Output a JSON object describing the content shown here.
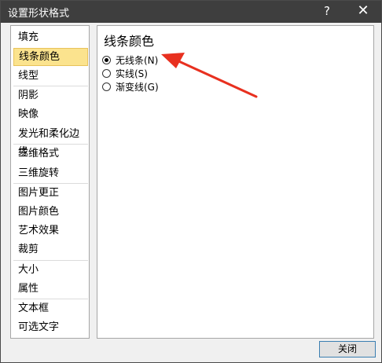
{
  "window": {
    "title": "设置形状格式",
    "help": "?",
    "close": "✕"
  },
  "sidebar": {
    "items": [
      "填充",
      "线条颜色",
      "线型",
      "阴影",
      "映像",
      "发光和柔化边缘",
      "三维格式",
      "三维旋转",
      "图片更正",
      "图片颜色",
      "艺术效果",
      "裁剪",
      "大小",
      "属性",
      "文本框",
      "可选文字"
    ],
    "selected": "线条颜色"
  },
  "panel": {
    "title": "线条颜色",
    "options": [
      {
        "label": "无线条(N)",
        "checked": true
      },
      {
        "label": "实线(S)",
        "checked": false
      },
      {
        "label": "渐变线(G)",
        "checked": false
      }
    ]
  },
  "footer": {
    "close_label": "关闭"
  },
  "colors": {
    "titlebar": "#3e3e3e",
    "selected": "#fbe38e",
    "arrow": "#e8301f"
  }
}
